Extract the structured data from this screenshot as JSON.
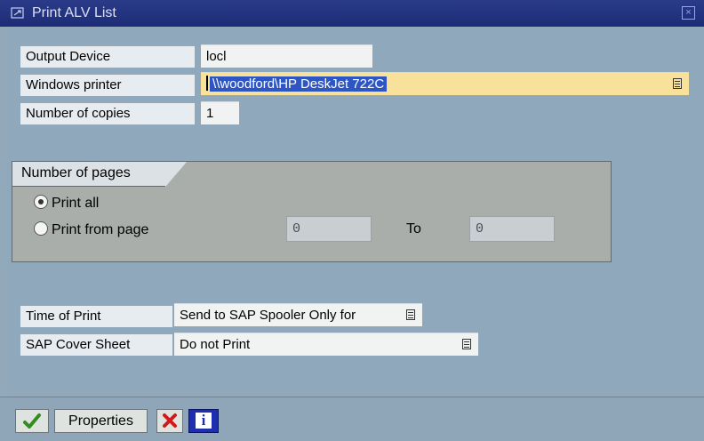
{
  "window": {
    "title": "Print ALV List",
    "close_glyph": "×"
  },
  "form": {
    "output_device": {
      "label": "Output Device",
      "value": "locl"
    },
    "windows_printer": {
      "label": "Windows printer",
      "value": "\\\\woodford\\HP DeskJet 722C",
      "icon": "dropdown-list-icon"
    },
    "copies": {
      "label": "Number of copies",
      "value": "1"
    }
  },
  "pages_group": {
    "title": "Number of pages",
    "print_all": "Print all",
    "print_from": "Print from page",
    "from_value": "0",
    "to_label": "To",
    "to_value": "0",
    "selected": "print_all"
  },
  "time_of_print": {
    "label": "Time of Print",
    "value": "Send to SAP Spooler Only for",
    "icon": "dropdown-list-icon"
  },
  "cover_sheet": {
    "label": "SAP Cover Sheet",
    "value": "Do not Print",
    "icon": "dropdown-list-icon"
  },
  "toolbar": {
    "ok_icon": "green-check-icon",
    "properties_label": "Properties",
    "cancel_icon": "red-x-icon",
    "info_icon": "info-icon",
    "info_glyph": "i"
  },
  "colors": {
    "titlebar": "#1d2c76",
    "body": "#8fa8bb",
    "selection": "#2d55c4",
    "required_field": "#f8e29b"
  }
}
